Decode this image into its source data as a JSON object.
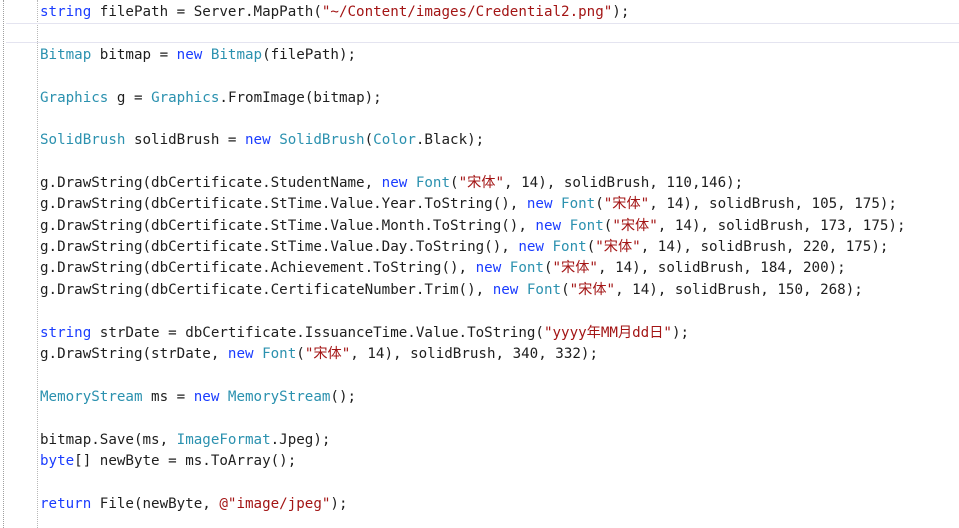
{
  "colors": {
    "keyword": "#1a3cff",
    "type": "#2b91af",
    "string": "#a31515",
    "plain": "#1e1e1e",
    "background": "#ffffff"
  },
  "code_lines": [
    [
      {
        "t": "string",
        "c": "kw"
      },
      {
        "t": " filePath = Server.MapPath(",
        "c": "p"
      },
      {
        "t": "\"~/Content/images/Credential2.png\"",
        "c": "str"
      },
      {
        "t": ");",
        "c": "p"
      }
    ],
    [],
    [
      {
        "t": "Bitmap",
        "c": "ty"
      },
      {
        "t": " bitmap = ",
        "c": "p"
      },
      {
        "t": "new",
        "c": "kw"
      },
      {
        "t": " ",
        "c": "p"
      },
      {
        "t": "Bitmap",
        "c": "ty"
      },
      {
        "t": "(filePath);",
        "c": "p"
      }
    ],
    [],
    [
      {
        "t": "Graphics",
        "c": "ty"
      },
      {
        "t": " g = ",
        "c": "p"
      },
      {
        "t": "Graphics",
        "c": "ty"
      },
      {
        "t": ".FromImage(bitmap);",
        "c": "p"
      }
    ],
    [],
    [
      {
        "t": "SolidBrush",
        "c": "ty"
      },
      {
        "t": " solidBrush = ",
        "c": "p"
      },
      {
        "t": "new",
        "c": "kw"
      },
      {
        "t": " ",
        "c": "p"
      },
      {
        "t": "SolidBrush",
        "c": "ty"
      },
      {
        "t": "(",
        "c": "p"
      },
      {
        "t": "Color",
        "c": "ty"
      },
      {
        "t": ".Black);",
        "c": "p"
      }
    ],
    [],
    [
      {
        "t": "g.DrawString(dbCertificate.StudentName, ",
        "c": "p"
      },
      {
        "t": "new",
        "c": "kw"
      },
      {
        "t": " ",
        "c": "p"
      },
      {
        "t": "Font",
        "c": "ty"
      },
      {
        "t": "(",
        "c": "p"
      },
      {
        "t": "\"宋体\"",
        "c": "str"
      },
      {
        "t": ", 14), solidBrush, 110,146);",
        "c": "p"
      }
    ],
    [
      {
        "t": "g.DrawString(dbCertificate.StTime.Value.Year.ToString(), ",
        "c": "p"
      },
      {
        "t": "new",
        "c": "kw"
      },
      {
        "t": " ",
        "c": "p"
      },
      {
        "t": "Font",
        "c": "ty"
      },
      {
        "t": "(",
        "c": "p"
      },
      {
        "t": "\"宋体\"",
        "c": "str"
      },
      {
        "t": ", 14), solidBrush, 105, 175);",
        "c": "p"
      }
    ],
    [
      {
        "t": "g.DrawString(dbCertificate.StTime.Value.Month.ToString(), ",
        "c": "p"
      },
      {
        "t": "new",
        "c": "kw"
      },
      {
        "t": " ",
        "c": "p"
      },
      {
        "t": "Font",
        "c": "ty"
      },
      {
        "t": "(",
        "c": "p"
      },
      {
        "t": "\"宋体\"",
        "c": "str"
      },
      {
        "t": ", 14), solidBrush, 173, 175);",
        "c": "p"
      }
    ],
    [
      {
        "t": "g.DrawString(dbCertificate.StTime.Value.Day.ToString(), ",
        "c": "p"
      },
      {
        "t": "new",
        "c": "kw"
      },
      {
        "t": " ",
        "c": "p"
      },
      {
        "t": "Font",
        "c": "ty"
      },
      {
        "t": "(",
        "c": "p"
      },
      {
        "t": "\"宋体\"",
        "c": "str"
      },
      {
        "t": ", 14), solidBrush, 220, 175);",
        "c": "p"
      }
    ],
    [
      {
        "t": "g.DrawString(dbCertificate.Achievement.ToString(), ",
        "c": "p"
      },
      {
        "t": "new",
        "c": "kw"
      },
      {
        "t": " ",
        "c": "p"
      },
      {
        "t": "Font",
        "c": "ty"
      },
      {
        "t": "(",
        "c": "p"
      },
      {
        "t": "\"宋体\"",
        "c": "str"
      },
      {
        "t": ", 14), solidBrush, 184, 200);",
        "c": "p"
      }
    ],
    [
      {
        "t": "g.DrawString(dbCertificate.CertificateNumber.Trim(), ",
        "c": "p"
      },
      {
        "t": "new",
        "c": "kw"
      },
      {
        "t": " ",
        "c": "p"
      },
      {
        "t": "Font",
        "c": "ty"
      },
      {
        "t": "(",
        "c": "p"
      },
      {
        "t": "\"宋体\"",
        "c": "str"
      },
      {
        "t": ", 14), solidBrush, 150, 268);",
        "c": "p"
      }
    ],
    [],
    [
      {
        "t": "string",
        "c": "kw"
      },
      {
        "t": " strDate = dbCertificate.IssuanceTime.Value.ToString(",
        "c": "p"
      },
      {
        "t": "\"yyyy年MM月dd日\"",
        "c": "str"
      },
      {
        "t": ");",
        "c": "p"
      }
    ],
    [
      {
        "t": "g.DrawString(strDate, ",
        "c": "p"
      },
      {
        "t": "new",
        "c": "kw"
      },
      {
        "t": " ",
        "c": "p"
      },
      {
        "t": "Font",
        "c": "ty"
      },
      {
        "t": "(",
        "c": "p"
      },
      {
        "t": "\"宋体\"",
        "c": "str"
      },
      {
        "t": ", 14), solidBrush, 340, 332);",
        "c": "p"
      }
    ],
    [],
    [
      {
        "t": "MemoryStream",
        "c": "ty"
      },
      {
        "t": " ms = ",
        "c": "p"
      },
      {
        "t": "new",
        "c": "kw"
      },
      {
        "t": " ",
        "c": "p"
      },
      {
        "t": "MemoryStream",
        "c": "ty"
      },
      {
        "t": "();",
        "c": "p"
      }
    ],
    [],
    [
      {
        "t": "bitmap.Save(ms, ",
        "c": "p"
      },
      {
        "t": "ImageFormat",
        "c": "ty"
      },
      {
        "t": ".Jpeg);",
        "c": "p"
      }
    ],
    [
      {
        "t": "byte",
        "c": "kw"
      },
      {
        "t": "[] newByte = ms.ToArray();",
        "c": "p"
      }
    ],
    [],
    [
      {
        "t": "return",
        "c": "kw"
      },
      {
        "t": " File(newByte, ",
        "c": "p"
      },
      {
        "t": "@\"image/jpeg\"",
        "c": "str"
      },
      {
        "t": ");",
        "c": "p"
      }
    ]
  ]
}
